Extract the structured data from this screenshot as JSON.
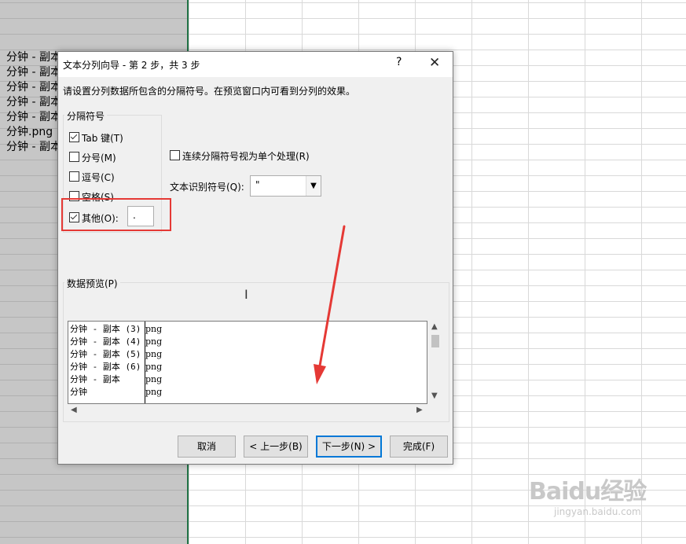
{
  "spreadsheet": {
    "cells": [
      "分钟 - 副本",
      "分钟 - 副本",
      "分钟 - 副本",
      "分钟 - 副本",
      "分钟 - 副本",
      "分钟.png",
      "分钟 - 副本"
    ],
    "accent_color": "#217346"
  },
  "dialog": {
    "title": "文本分列向导 - 第 2 步，共 3 步",
    "help_label": "?",
    "close_label": "✕",
    "instruction": "请设置分列数据所包含的分隔符号。在预览窗口内可看到分列的效果。",
    "delimiters": {
      "group_label": "分隔符号",
      "tab": {
        "label": "Tab 键(T)",
        "checked": true
      },
      "semicolon": {
        "label": "分号(M)",
        "checked": false
      },
      "comma": {
        "label": "逗号(C)",
        "checked": false
      },
      "space": {
        "label": "空格(S)",
        "checked": false
      },
      "other": {
        "label": "其他(O):",
        "checked": true,
        "value": "."
      }
    },
    "consecutive": {
      "label": "连续分隔符号视为单个处理(R)",
      "checked": false
    },
    "qualifier": {
      "label": "文本识别符号(Q):",
      "value": "\""
    },
    "preview": {
      "label": "数据预览(P)",
      "rows": [
        {
          "c1": "分钟 - 副本 (3)",
          "c2": "png"
        },
        {
          "c1": "分钟 - 副本 (4)",
          "c2": "png"
        },
        {
          "c1": "分钟 - 副本 (5)",
          "c2": "png"
        },
        {
          "c1": "分钟 - 副本 (6)",
          "c2": "png"
        },
        {
          "c1": "分钟 - 副本",
          "c2": "png"
        },
        {
          "c1": "分钟",
          "c2": "png"
        }
      ]
    },
    "buttons": {
      "cancel": "取消",
      "back": "< 上一步(B)",
      "next": "下一步(N) >",
      "finish": "完成(F)"
    }
  },
  "annotation": {
    "highlight_color": "#e53935"
  },
  "watermark": {
    "logo": "Baidu经验",
    "sub": "jingyan.baidu.com"
  }
}
